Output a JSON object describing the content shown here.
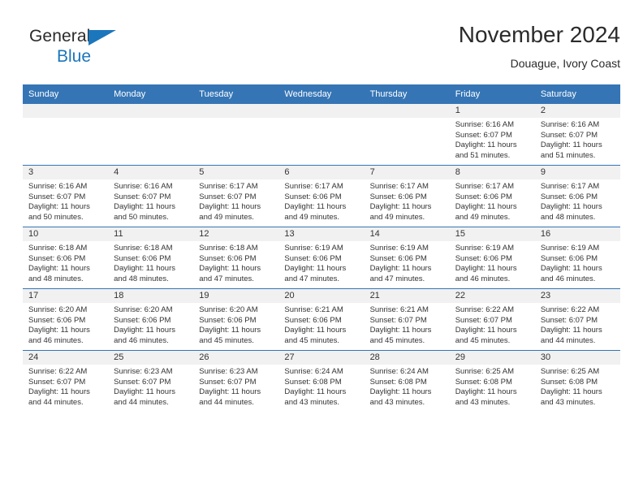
{
  "brand": {
    "name_part1": "General",
    "name_part2": "Blue",
    "accent_color": "#1b76bc",
    "triangle_icon": "triangle-logo-icon"
  },
  "header": {
    "month_title": "November 2024",
    "location": "Douague, Ivory Coast"
  },
  "calendar": {
    "header_background": "#3575b5",
    "date_band_background": "#f1f1f1",
    "weekday_headers": [
      "Sunday",
      "Monday",
      "Tuesday",
      "Wednesday",
      "Thursday",
      "Friday",
      "Saturday"
    ],
    "weeks": [
      [
        {
          "date": "",
          "empty": true
        },
        {
          "date": "",
          "empty": true
        },
        {
          "date": "",
          "empty": true
        },
        {
          "date": "",
          "empty": true
        },
        {
          "date": "",
          "empty": true
        },
        {
          "date": "1",
          "sunrise": "Sunrise: 6:16 AM",
          "sunset": "Sunset: 6:07 PM",
          "daylight_line1": "Daylight: 11 hours",
          "daylight_line2": "and 51 minutes."
        },
        {
          "date": "2",
          "sunrise": "Sunrise: 6:16 AM",
          "sunset": "Sunset: 6:07 PM",
          "daylight_line1": "Daylight: 11 hours",
          "daylight_line2": "and 51 minutes."
        }
      ],
      [
        {
          "date": "3",
          "sunrise": "Sunrise: 6:16 AM",
          "sunset": "Sunset: 6:07 PM",
          "daylight_line1": "Daylight: 11 hours",
          "daylight_line2": "and 50 minutes."
        },
        {
          "date": "4",
          "sunrise": "Sunrise: 6:16 AM",
          "sunset": "Sunset: 6:07 PM",
          "daylight_line1": "Daylight: 11 hours",
          "daylight_line2": "and 50 minutes."
        },
        {
          "date": "5",
          "sunrise": "Sunrise: 6:17 AM",
          "sunset": "Sunset: 6:07 PM",
          "daylight_line1": "Daylight: 11 hours",
          "daylight_line2": "and 49 minutes."
        },
        {
          "date": "6",
          "sunrise": "Sunrise: 6:17 AM",
          "sunset": "Sunset: 6:06 PM",
          "daylight_line1": "Daylight: 11 hours",
          "daylight_line2": "and 49 minutes."
        },
        {
          "date": "7",
          "sunrise": "Sunrise: 6:17 AM",
          "sunset": "Sunset: 6:06 PM",
          "daylight_line1": "Daylight: 11 hours",
          "daylight_line2": "and 49 minutes."
        },
        {
          "date": "8",
          "sunrise": "Sunrise: 6:17 AM",
          "sunset": "Sunset: 6:06 PM",
          "daylight_line1": "Daylight: 11 hours",
          "daylight_line2": "and 49 minutes."
        },
        {
          "date": "9",
          "sunrise": "Sunrise: 6:17 AM",
          "sunset": "Sunset: 6:06 PM",
          "daylight_line1": "Daylight: 11 hours",
          "daylight_line2": "and 48 minutes."
        }
      ],
      [
        {
          "date": "10",
          "sunrise": "Sunrise: 6:18 AM",
          "sunset": "Sunset: 6:06 PM",
          "daylight_line1": "Daylight: 11 hours",
          "daylight_line2": "and 48 minutes."
        },
        {
          "date": "11",
          "sunrise": "Sunrise: 6:18 AM",
          "sunset": "Sunset: 6:06 PM",
          "daylight_line1": "Daylight: 11 hours",
          "daylight_line2": "and 48 minutes."
        },
        {
          "date": "12",
          "sunrise": "Sunrise: 6:18 AM",
          "sunset": "Sunset: 6:06 PM",
          "daylight_line1": "Daylight: 11 hours",
          "daylight_line2": "and 47 minutes."
        },
        {
          "date": "13",
          "sunrise": "Sunrise: 6:19 AM",
          "sunset": "Sunset: 6:06 PM",
          "daylight_line1": "Daylight: 11 hours",
          "daylight_line2": "and 47 minutes."
        },
        {
          "date": "14",
          "sunrise": "Sunrise: 6:19 AM",
          "sunset": "Sunset: 6:06 PM",
          "daylight_line1": "Daylight: 11 hours",
          "daylight_line2": "and 47 minutes."
        },
        {
          "date": "15",
          "sunrise": "Sunrise: 6:19 AM",
          "sunset": "Sunset: 6:06 PM",
          "daylight_line1": "Daylight: 11 hours",
          "daylight_line2": "and 46 minutes."
        },
        {
          "date": "16",
          "sunrise": "Sunrise: 6:19 AM",
          "sunset": "Sunset: 6:06 PM",
          "daylight_line1": "Daylight: 11 hours",
          "daylight_line2": "and 46 minutes."
        }
      ],
      [
        {
          "date": "17",
          "sunrise": "Sunrise: 6:20 AM",
          "sunset": "Sunset: 6:06 PM",
          "daylight_line1": "Daylight: 11 hours",
          "daylight_line2": "and 46 minutes."
        },
        {
          "date": "18",
          "sunrise": "Sunrise: 6:20 AM",
          "sunset": "Sunset: 6:06 PM",
          "daylight_line1": "Daylight: 11 hours",
          "daylight_line2": "and 46 minutes."
        },
        {
          "date": "19",
          "sunrise": "Sunrise: 6:20 AM",
          "sunset": "Sunset: 6:06 PM",
          "daylight_line1": "Daylight: 11 hours",
          "daylight_line2": "and 45 minutes."
        },
        {
          "date": "20",
          "sunrise": "Sunrise: 6:21 AM",
          "sunset": "Sunset: 6:06 PM",
          "daylight_line1": "Daylight: 11 hours",
          "daylight_line2": "and 45 minutes."
        },
        {
          "date": "21",
          "sunrise": "Sunrise: 6:21 AM",
          "sunset": "Sunset: 6:07 PM",
          "daylight_line1": "Daylight: 11 hours",
          "daylight_line2": "and 45 minutes."
        },
        {
          "date": "22",
          "sunrise": "Sunrise: 6:22 AM",
          "sunset": "Sunset: 6:07 PM",
          "daylight_line1": "Daylight: 11 hours",
          "daylight_line2": "and 45 minutes."
        },
        {
          "date": "23",
          "sunrise": "Sunrise: 6:22 AM",
          "sunset": "Sunset: 6:07 PM",
          "daylight_line1": "Daylight: 11 hours",
          "daylight_line2": "and 44 minutes."
        }
      ],
      [
        {
          "date": "24",
          "sunrise": "Sunrise: 6:22 AM",
          "sunset": "Sunset: 6:07 PM",
          "daylight_line1": "Daylight: 11 hours",
          "daylight_line2": "and 44 minutes."
        },
        {
          "date": "25",
          "sunrise": "Sunrise: 6:23 AM",
          "sunset": "Sunset: 6:07 PM",
          "daylight_line1": "Daylight: 11 hours",
          "daylight_line2": "and 44 minutes."
        },
        {
          "date": "26",
          "sunrise": "Sunrise: 6:23 AM",
          "sunset": "Sunset: 6:07 PM",
          "daylight_line1": "Daylight: 11 hours",
          "daylight_line2": "and 44 minutes."
        },
        {
          "date": "27",
          "sunrise": "Sunrise: 6:24 AM",
          "sunset": "Sunset: 6:08 PM",
          "daylight_line1": "Daylight: 11 hours",
          "daylight_line2": "and 43 minutes."
        },
        {
          "date": "28",
          "sunrise": "Sunrise: 6:24 AM",
          "sunset": "Sunset: 6:08 PM",
          "daylight_line1": "Daylight: 11 hours",
          "daylight_line2": "and 43 minutes."
        },
        {
          "date": "29",
          "sunrise": "Sunrise: 6:25 AM",
          "sunset": "Sunset: 6:08 PM",
          "daylight_line1": "Daylight: 11 hours",
          "daylight_line2": "and 43 minutes."
        },
        {
          "date": "30",
          "sunrise": "Sunrise: 6:25 AM",
          "sunset": "Sunset: 6:08 PM",
          "daylight_line1": "Daylight: 11 hours",
          "daylight_line2": "and 43 minutes."
        }
      ]
    ]
  }
}
